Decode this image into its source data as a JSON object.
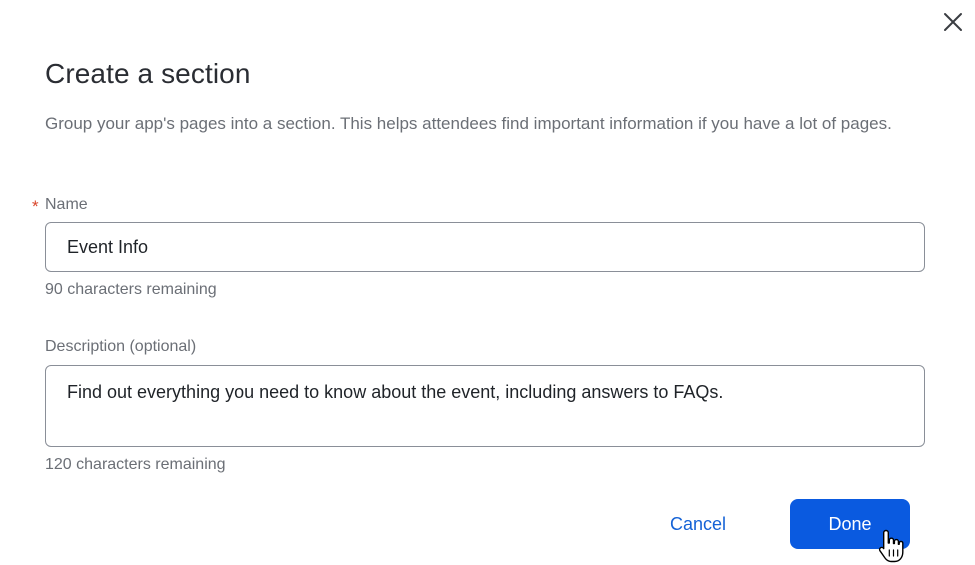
{
  "dialog": {
    "title": "Create a section",
    "intro": "Group your app's pages into a section. This helps attendees find important information if you have a lot of pages.",
    "close_icon": "close-icon"
  },
  "name_field": {
    "required_marker": "*",
    "label": "Name",
    "value": "Event Info",
    "helper": "90 characters remaining"
  },
  "description_field": {
    "label": "Description (optional)",
    "value": "Find out everything you need to know about the event, including answers to FAQs.",
    "helper": "120 characters remaining"
  },
  "actions": {
    "cancel_label": "Cancel",
    "done_label": "Done"
  },
  "colors": {
    "primary": "#0a5ae0",
    "link": "#1462d6",
    "required": "#d9462b"
  },
  "cursor_icon": "hand-pointer-icon"
}
